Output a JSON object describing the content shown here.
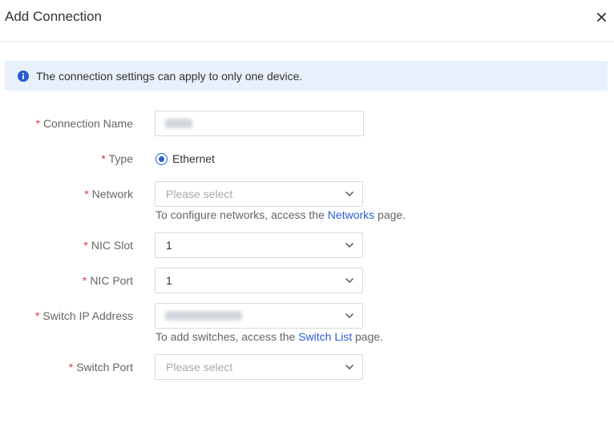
{
  "dialog": {
    "title": "Add Connection",
    "close_glyph": "×"
  },
  "notice": {
    "icon": "info-icon",
    "text": "The connection settings can apply to only one device."
  },
  "form": {
    "required_mark": "*",
    "connection_name": {
      "label": "Connection Name",
      "value": ""
    },
    "type": {
      "label": "Type",
      "option": "Ethernet",
      "selected": true
    },
    "network": {
      "label": "Network",
      "placeholder": "Please select",
      "hint_before": "To configure networks, access the ",
      "hint_link": "Networks",
      "hint_after": " page."
    },
    "nic_slot": {
      "label": "NIC Slot",
      "value": "1"
    },
    "nic_port": {
      "label": "NIC Port",
      "value": "1"
    },
    "switch_ip": {
      "label": "Switch IP Address",
      "value": "",
      "hint_before": "To add switches, access the ",
      "hint_link": "Switch List",
      "hint_after": " page."
    },
    "switch_port": {
      "label": "Switch Port",
      "placeholder": "Please select"
    }
  },
  "colors": {
    "accent": "#2a5ccf",
    "required": "#e0363b",
    "notice_bg": "#e8f0fb"
  }
}
